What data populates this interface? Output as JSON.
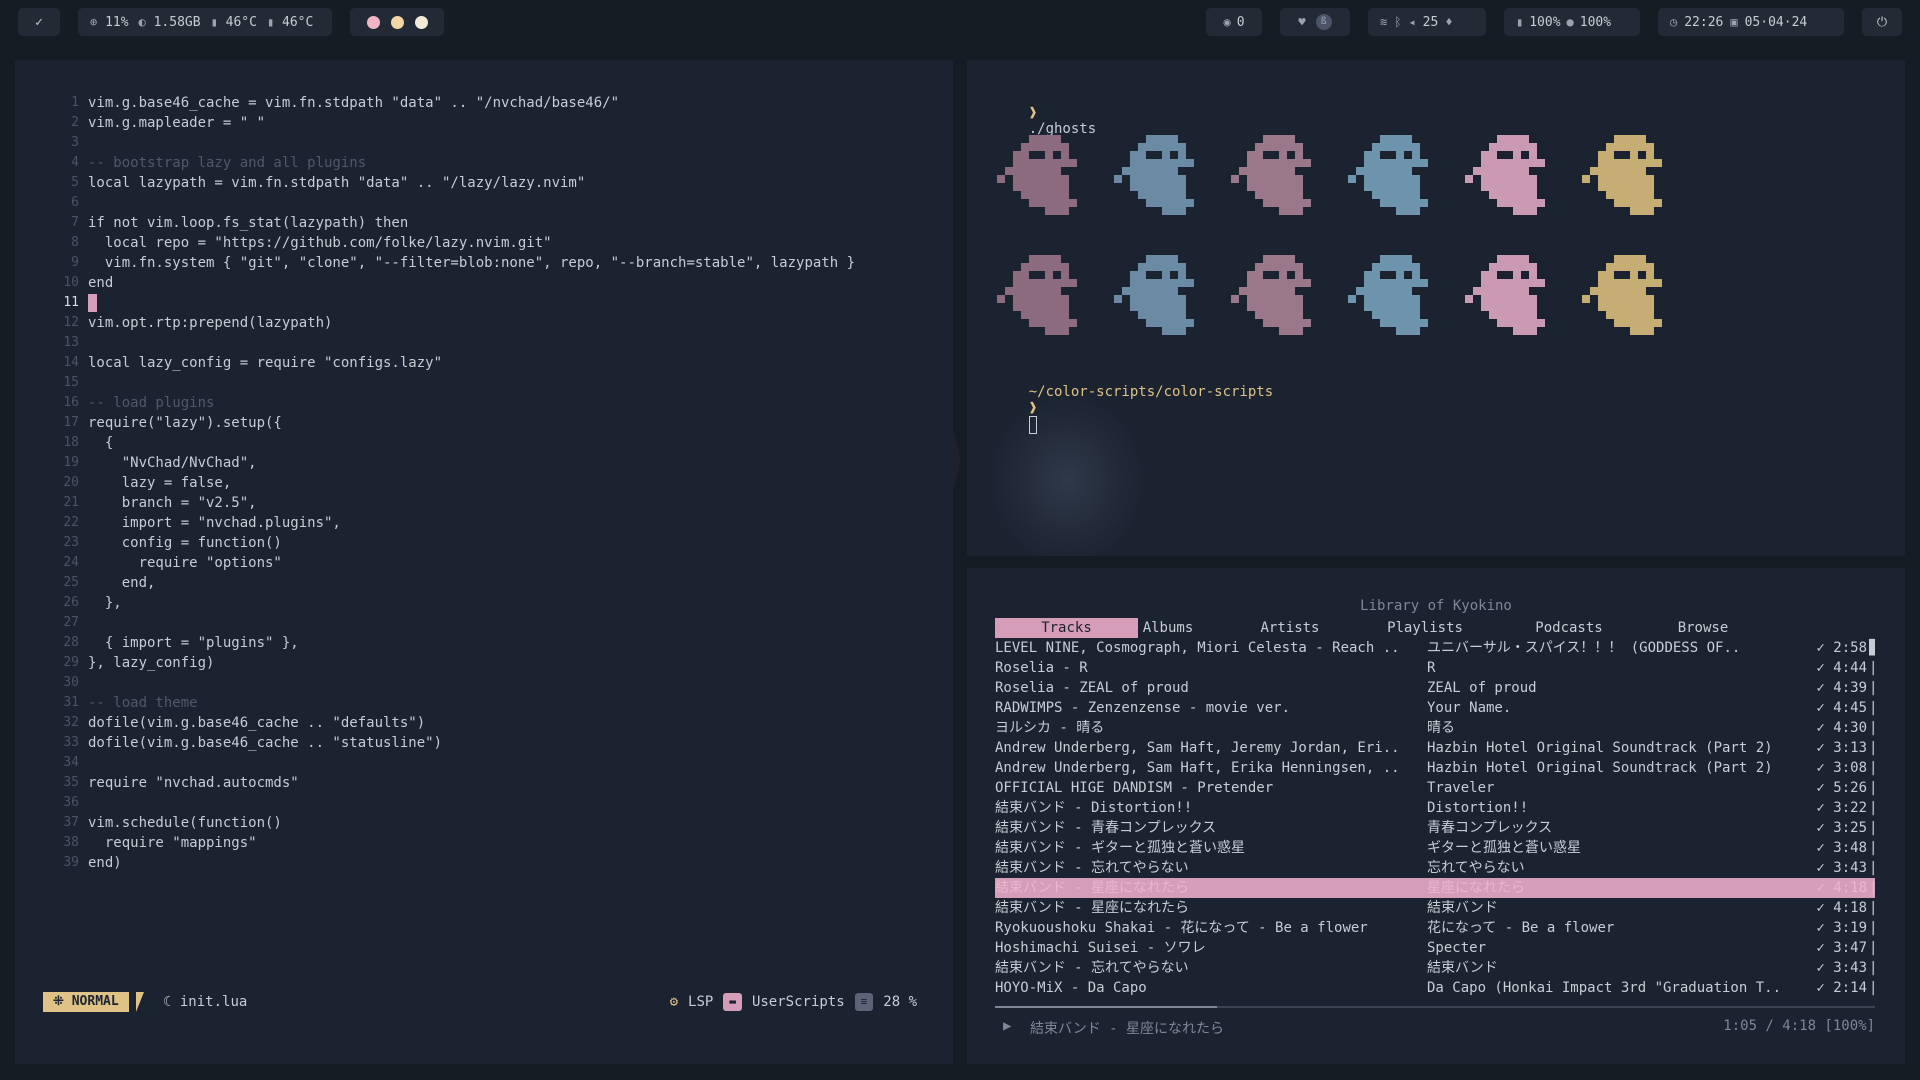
{
  "topbar": {
    "launcher_icon": "check-icon",
    "system": {
      "cpu": "11%",
      "ram": "1.58GB",
      "temp1": "46°C",
      "temp2": "46°C"
    },
    "workspace_dot_colors": [
      "#f0b6c8",
      "#f3d6a8",
      "#f4ead8"
    ],
    "notifications": "0",
    "network": {
      "volume": "25"
    },
    "battery": {
      "level1": "100%",
      "level2": "100%"
    },
    "clock": {
      "time": "22:26",
      "date": "05·04·24"
    },
    "power_icon": "power-icon"
  },
  "editor": {
    "current_line": 11,
    "lines": [
      "vim.g.base46_cache = vim.fn.stdpath \"data\" .. \"/nvchad/base46/\"",
      "vim.g.mapleader = \" \"",
      "",
      "-- bootstrap lazy and all plugins",
      "local lazypath = vim.fn.stdpath \"data\" .. \"/lazy/lazy.nvim\"",
      "",
      "if not vim.loop.fs_stat(lazypath) then",
      "  local repo = \"https://github.com/folke/lazy.nvim.git\"",
      "  vim.fn.system { \"git\", \"clone\", \"--filter=blob:none\", repo, \"--branch=stable\", lazypath }",
      "end",
      "",
      "vim.opt.rtp:prepend(lazypath)",
      "",
      "local lazy_config = require \"configs.lazy\"",
      "",
      "-- load plugins",
      "require(\"lazy\").setup({",
      "  {",
      "    \"NvChad/NvChad\",",
      "    lazy = false,",
      "    branch = \"v2.5\",",
      "    import = \"nvchad.plugins\",",
      "    config = function()",
      "      require \"options\"",
      "    end,",
      "  },",
      "",
      "  { import = \"plugins\" },",
      "}, lazy_config)",
      "",
      "-- load theme",
      "dofile(vim.g.base46_cache .. \"defaults\")",
      "dofile(vim.g.base46_cache .. \"statusline\")",
      "",
      "require \"nvchad.autocmds\"",
      "",
      "vim.schedule(function()",
      "  require \"mappings\"",
      "end)"
    ],
    "statusline": {
      "mode": "NORMAL",
      "file": "init.lua",
      "lsp": "LSP",
      "cwd": "UserScripts",
      "percent": "28 %"
    }
  },
  "terminal": {
    "command_prompt": "❱",
    "command": "./ghosts",
    "ghost_colors": [
      "#8c6b7e",
      "#6a8ba3",
      "#9a788a",
      "#6e93ad",
      "#c99ab2",
      "#c6ad74"
    ],
    "cwd": "~/color-scripts/color-scripts",
    "prompt_symbol": "❱"
  },
  "music": {
    "title": "Library of Kyokino",
    "tabs": [
      "Tracks",
      "Albums",
      "Artists",
      "Playlists",
      "Podcasts",
      "Browse"
    ],
    "active_tab": 0,
    "selected_row": 12,
    "tracks": [
      {
        "track": "LEVEL NINE, Cosmograph, Miori Celesta - Reach ..",
        "album": "ユニバーサル・スパイス！！！ (GODDESS OF..",
        "duration": "✓ 2:58"
      },
      {
        "track": "Roselia - R",
        "album": "R",
        "duration": "✓ 4:44"
      },
      {
        "track": "Roselia - ZEAL of proud",
        "album": "ZEAL of proud",
        "duration": "✓ 4:39"
      },
      {
        "track": "RADWIMPS - Zenzenzense - movie ver.",
        "album": "Your Name.",
        "duration": "✓ 4:45"
      },
      {
        "track": "ヨルシカ - 晴る",
        "album": "晴る",
        "duration": "✓ 4:30"
      },
      {
        "track": "Andrew Underberg, Sam Haft, Jeremy Jordan, Eri..",
        "album": "Hazbin Hotel Original Soundtrack (Part 2)",
        "duration": "✓ 3:13"
      },
      {
        "track": "Andrew Underberg, Sam Haft, Erika Henningsen, ..",
        "album": "Hazbin Hotel Original Soundtrack (Part 2)",
        "duration": "✓ 3:08"
      },
      {
        "track": "OFFICIAL HIGE DANDISM - Pretender",
        "album": "Traveler",
        "duration": "✓ 5:26"
      },
      {
        "track": "結束バンド - Distortion!!",
        "album": "Distortion!!",
        "duration": "✓ 3:22"
      },
      {
        "track": "結束バンド - 青春コンプレックス",
        "album": "青春コンプレックス",
        "duration": "✓ 3:25"
      },
      {
        "track": "結束バンド - ギターと孤独と蒼い惑星",
        "album": "ギターと孤独と蒼い惑星",
        "duration": "✓ 3:48"
      },
      {
        "track": "結束バンド - 忘れてやらない",
        "album": "忘れてやらない",
        "duration": "✓ 3:43"
      },
      {
        "track": "結束バンド - 星座になれたら",
        "album": "星座になれたら",
        "duration": "✓ 4:18"
      },
      {
        "track": "結束バンド - 星座になれたら",
        "album": "結束バンド",
        "duration": "✓ 4:18"
      },
      {
        "track": "Ryokuoushoku Shakai - 花になって - Be a flower",
        "album": "花になって - Be a flower",
        "duration": "✓ 3:19"
      },
      {
        "track": "Hoshimachi Suisei - ソワレ",
        "album": "Specter",
        "duration": "✓ 3:47"
      },
      {
        "track": "結束バンド - 忘れてやらない",
        "album": "結束バンド",
        "duration": "✓ 3:43"
      },
      {
        "track": "HOYO-MiX - Da Capo",
        "album": "Da Capo (Honkai Impact 3rd \"Graduation T..",
        "duration": "✓ 2:14"
      }
    ],
    "now_playing": {
      "play_icon": "play-icon",
      "title": "結束バンド - 星座になれたら",
      "time": "1:05 / 4:18 [100%]",
      "progress": 0.252
    }
  }
}
